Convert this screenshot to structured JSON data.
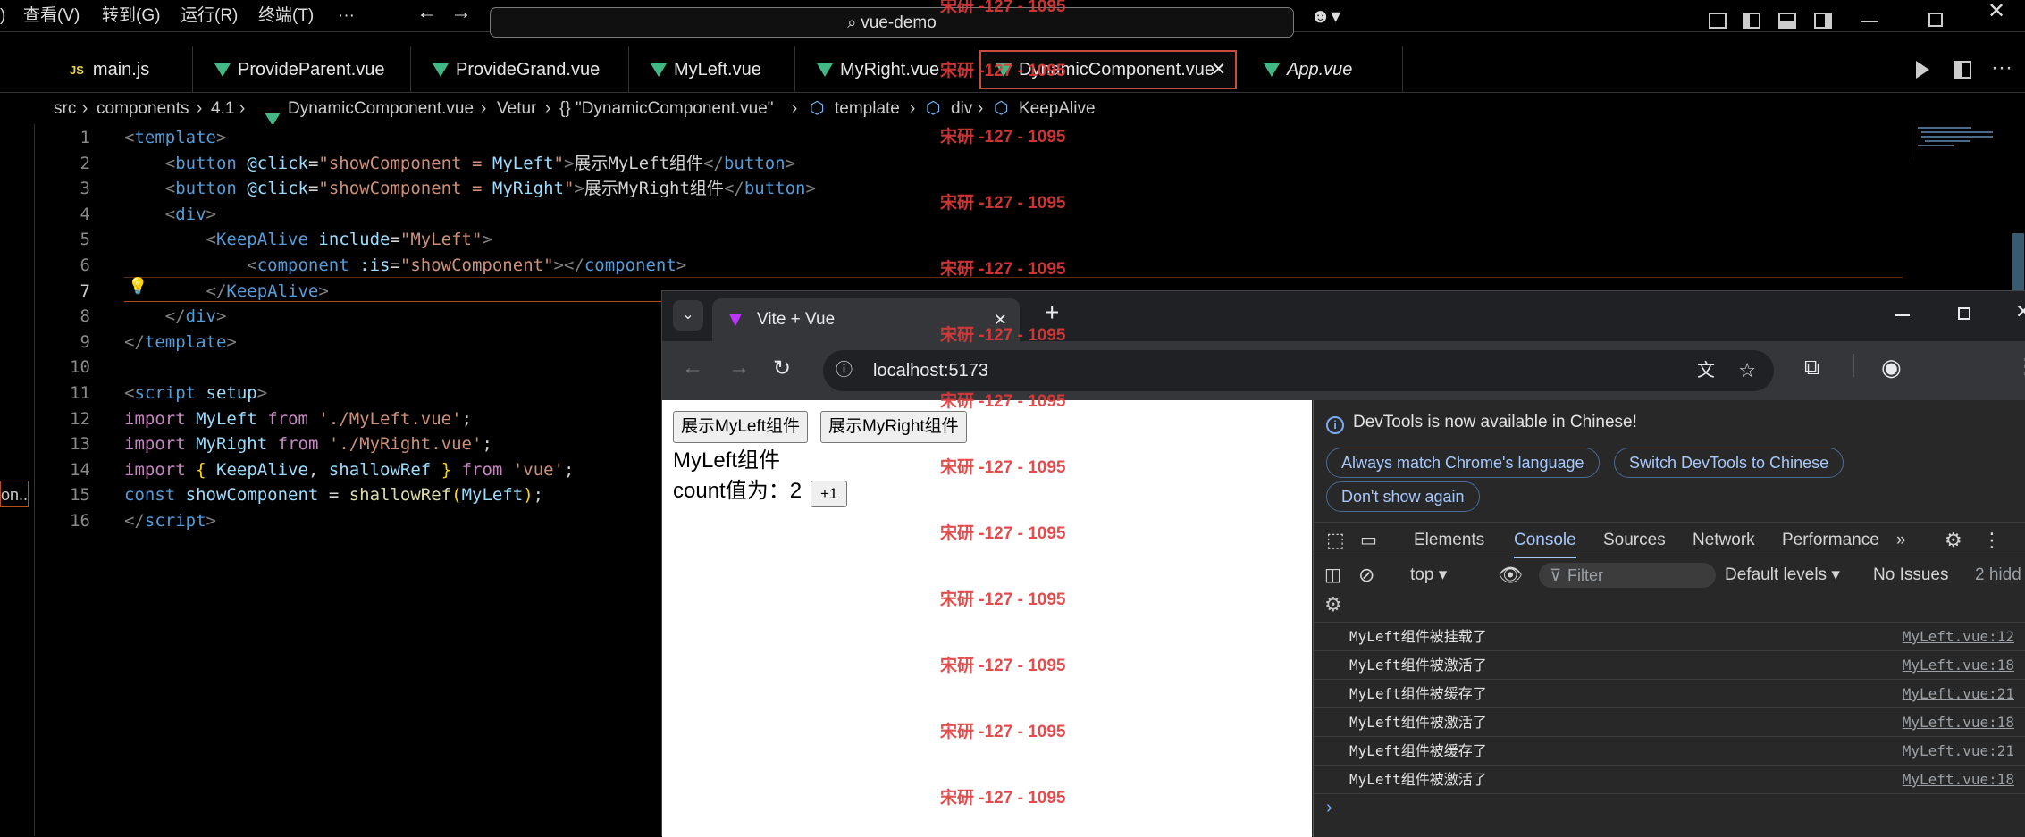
{
  "menubar": {
    "partial_item": ")",
    "items": [
      "查看(V)",
      "转到(G)",
      "运行(R)",
      "终端(T)"
    ],
    "more": "···",
    "search_text": "vue-demo"
  },
  "tabs": [
    {
      "label": "main.js",
      "icon": "js"
    },
    {
      "label": "ProvideParent.vue",
      "icon": "vue"
    },
    {
      "label": "ProvideGrand.vue",
      "icon": "vue"
    },
    {
      "label": "MyLeft.vue",
      "icon": "vue"
    },
    {
      "label": "MyRight.vue",
      "icon": "vue"
    },
    {
      "label": "DynamicComponent.vue",
      "icon": "vue",
      "active": true
    },
    {
      "label": "App.vue",
      "icon": "vue"
    }
  ],
  "breadcrumb": [
    "src",
    "components",
    "4.1",
    "DynamicComponent.vue",
    "Vetur",
    "{} \"DynamicComponent.vue\"",
    "template",
    "div",
    "KeepAlive"
  ],
  "left_sidebar_partial": "on...",
  "watermark": "宋研 -127 - 1095",
  "browser": {
    "tab_title": "Vite + Vue",
    "url": "localhost:5173",
    "page": {
      "button_left": "展示MyLeft组件",
      "button_right": "展示MyRight组件",
      "component_title": "MyLeft组件",
      "count_label": "count值为：2",
      "increment_button": "+1"
    },
    "devtools": {
      "banner": "DevTools is now available in Chinese!",
      "banner_buttons": [
        "Always match Chrome's language",
        "Switch DevTools to Chinese",
        "Don't show again"
      ],
      "tabs": [
        "Elements",
        "Console",
        "Sources",
        "Network",
        "Performance"
      ],
      "active_tab": "Console",
      "context": "top",
      "filter_placeholder": "Filter",
      "levels": "Default levels",
      "issues": "No Issues",
      "hidden": "2 hidd",
      "logs": [
        {
          "message": "MyLeft组件被挂载了",
          "source": "MyLeft.vue:12"
        },
        {
          "message": "MyLeft组件被激活了",
          "source": "MyLeft.vue:18"
        },
        {
          "message": "MyLeft组件被缓存了",
          "source": "MyLeft.vue:21"
        },
        {
          "message": "MyLeft组件被激活了",
          "source": "MyLeft.vue:18"
        },
        {
          "message": "MyLeft组件被缓存了",
          "source": "MyLeft.vue:21"
        },
        {
          "message": "MyLeft组件被激活了",
          "source": "MyLeft.vue:18"
        }
      ]
    }
  },
  "colors": {
    "accent": "#41b883",
    "active_tab_border": "#c94c3c",
    "watermark": "#e03a3a"
  }
}
